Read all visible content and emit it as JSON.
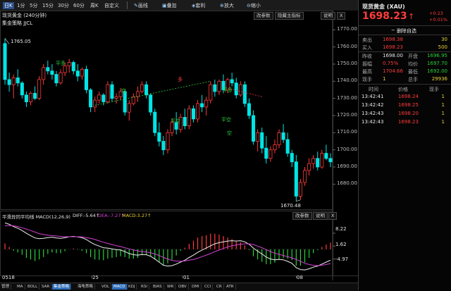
{
  "toolbar": {
    "intervals": [
      "日K",
      "1分",
      "5分",
      "15分",
      "30分",
      "60分"
    ],
    "active_interval": "日K",
    "buttons": [
      "周K",
      "自定义"
    ],
    "tools": [
      "画线",
      "叠加",
      "套利",
      "放大",
      "缩小"
    ]
  },
  "chart_header": {
    "title": "现货黄金 (240分钟)",
    "strategy": "集金策略 JJCL",
    "btn_params": "改参数",
    "btn_hide": "隐藏主指标",
    "btn_explain": "说明",
    "btn_close": "X"
  },
  "price_axis": [
    "1770.00",
    "1760.00",
    "1750.00",
    "1740.00",
    "1730.00",
    "1720.00",
    "1710.00",
    "1700.00",
    "1690.00",
    "1680.00"
  ],
  "annotations": {
    "high": "1765.05",
    "low": "1670.48",
    "markers": [
      "平多",
      "空",
      "平空",
      "平多",
      "平空",
      "空",
      "多"
    ]
  },
  "macd_header": {
    "title": "平滑异同平均线 MACD(12,26,9)",
    "diff": "DIFF:-5.64↑",
    "dea": "DEA:-7.27↑",
    "macd": "MACD:3.27↑",
    "btn_params": "改参数",
    "btn_explain": "说明",
    "btn_close": "X"
  },
  "macd_axis": [
    "8.22",
    "1.62",
    "-4.97"
  ],
  "date_axis": [
    "0518",
    "25",
    "01",
    "08"
  ],
  "bottom_tabs": [
    "管理",
    "MA",
    "BOLL",
    "SAR",
    "集金策略",
    "海龟策略",
    "VOL",
    "MACD",
    "KDJ",
    "RSI",
    "BIAS",
    "WR",
    "OBV",
    "DMI",
    "CCI",
    "CR",
    "ATR"
  ],
  "active_bottom_tab": "集金策略",
  "chart_data": {
    "type": "candlestick",
    "price_ylim": [
      1667,
      1773
    ],
    "candles": [
      [
        1762,
        1765,
        1738,
        1741
      ],
      [
        1741,
        1745,
        1734,
        1738
      ],
      [
        1738,
        1744,
        1730,
        1742
      ],
      [
        1742,
        1747,
        1737,
        1739
      ],
      [
        1739,
        1740,
        1730,
        1732
      ],
      [
        1732,
        1734,
        1725,
        1728
      ],
      [
        1728,
        1734,
        1726,
        1733
      ],
      [
        1733,
        1737,
        1729,
        1730
      ],
      [
        1730,
        1743,
        1729,
        1741
      ],
      [
        1741,
        1750,
        1738,
        1748
      ],
      [
        1748,
        1752,
        1744,
        1746
      ],
      [
        1746,
        1750,
        1741,
        1744
      ],
      [
        1744,
        1746,
        1737,
        1739
      ],
      [
        1739,
        1747,
        1738,
        1745
      ],
      [
        1745,
        1751,
        1743,
        1749
      ],
      [
        1749,
        1753,
        1745,
        1751
      ],
      [
        1751,
        1752,
        1744,
        1746
      ],
      [
        1746,
        1750,
        1740,
        1743
      ],
      [
        1743,
        1748,
        1741,
        1747
      ],
      [
        1747,
        1749,
        1733,
        1735
      ],
      [
        1735,
        1736,
        1722,
        1725
      ],
      [
        1725,
        1731,
        1722,
        1729
      ],
      [
        1729,
        1734,
        1727,
        1732
      ],
      [
        1732,
        1733,
        1726,
        1728
      ],
      [
        1728,
        1740,
        1727,
        1738
      ],
      [
        1738,
        1740,
        1728,
        1730
      ],
      [
        1730,
        1733,
        1727,
        1731
      ],
      [
        1731,
        1736,
        1729,
        1734
      ],
      [
        1734,
        1735,
        1720,
        1722
      ],
      [
        1722,
        1729,
        1717,
        1727
      ],
      [
        1727,
        1733,
        1726,
        1731
      ],
      [
        1731,
        1737,
        1728,
        1734
      ],
      [
        1734,
        1740,
        1733,
        1738
      ],
      [
        1738,
        1740,
        1730,
        1732
      ],
      [
        1732,
        1733,
        1720,
        1722
      ],
      [
        1722,
        1724,
        1708,
        1710
      ],
      [
        1710,
        1716,
        1702,
        1705
      ],
      [
        1705,
        1708,
        1697,
        1700
      ],
      [
        1700,
        1712,
        1698,
        1710
      ],
      [
        1710,
        1718,
        1708,
        1716
      ],
      [
        1716,
        1722,
        1709,
        1712
      ],
      [
        1712,
        1721,
        1710,
        1719
      ],
      [
        1719,
        1724,
        1712,
        1714
      ],
      [
        1714,
        1726,
        1712,
        1724
      ],
      [
        1724,
        1726,
        1716,
        1718
      ],
      [
        1718,
        1729,
        1716,
        1727
      ],
      [
        1727,
        1732,
        1722,
        1725
      ],
      [
        1725,
        1731,
        1720,
        1729
      ],
      [
        1729,
        1740,
        1727,
        1738
      ],
      [
        1738,
        1741,
        1731,
        1734
      ],
      [
        1734,
        1741,
        1732,
        1740
      ],
      [
        1740,
        1744,
        1733,
        1735
      ],
      [
        1735,
        1742,
        1733,
        1741
      ],
      [
        1741,
        1745,
        1737,
        1739
      ],
      [
        1739,
        1742,
        1730,
        1732
      ],
      [
        1732,
        1740,
        1731,
        1738
      ],
      [
        1738,
        1740,
        1725,
        1727
      ],
      [
        1727,
        1730,
        1718,
        1720
      ],
      [
        1720,
        1723,
        1703,
        1705
      ],
      [
        1705,
        1712,
        1699,
        1710
      ],
      [
        1710,
        1713,
        1698,
        1701
      ],
      [
        1701,
        1708,
        1692,
        1695
      ],
      [
        1695,
        1702,
        1693,
        1700
      ],
      [
        1700,
        1706,
        1698,
        1703
      ],
      [
        1703,
        1712,
        1701,
        1710
      ],
      [
        1710,
        1715,
        1704,
        1706
      ],
      [
        1706,
        1710,
        1696,
        1698
      ],
      [
        1698,
        1700,
        1690,
        1693
      ],
      [
        1693,
        1697,
        1670,
        1673
      ],
      [
        1673,
        1683,
        1671,
        1681
      ],
      [
        1681,
        1690,
        1679,
        1688
      ],
      [
        1688,
        1695,
        1685,
        1692
      ],
      [
        1692,
        1697,
        1689,
        1695
      ],
      [
        1695,
        1699,
        1688,
        1690
      ],
      [
        1690,
        1700,
        1689,
        1698
      ],
      [
        1698,
        1703,
        1694,
        1695
      ],
      [
        1695,
        1698,
        1690,
        1693
      ]
    ],
    "macd_ylim": [
      -12,
      14
    ],
    "diff": [
      13.5,
      12.8,
      11.6,
      10.8,
      9.6,
      8.2,
      7.0,
      5.8,
      5.4,
      5.6,
      6.0,
      6.2,
      5.8,
      5.6,
      5.9,
      6.4,
      6.6,
      6.3,
      5.9,
      5.0,
      3.6,
      2.4,
      1.6,
      0.8,
      0.6,
      0.2,
      -0.2,
      -0.4,
      -1.2,
      -2.2,
      -2.8,
      -3.0,
      -2.7,
      -2.8,
      -3.6,
      -5.0,
      -6.6,
      -8.2,
      -8.6,
      -8.4,
      -7.6,
      -6.6,
      -5.6,
      -4.2,
      -3.0,
      -1.6,
      -0.4,
      0.6,
      1.8,
      2.8,
      3.4,
      3.8,
      4.2,
      4.4,
      4.2,
      4.4,
      3.8,
      2.6,
      0.6,
      -1.0,
      -2.4,
      -4.0,
      -5.0,
      -5.4,
      -5.2,
      -5.4,
      -6.2,
      -7.2,
      -9.4,
      -10.4,
      -10.6,
      -10.0,
      -9.2,
      -8.6,
      -7.6,
      -6.6,
      -5.6
    ],
    "dea": [
      12.0,
      12.2,
      12.0,
      11.6,
      11.0,
      10.4,
      9.6,
      8.8,
      8.0,
      7.6,
      7.2,
      7.0,
      6.8,
      6.6,
      6.4,
      6.4,
      6.4,
      6.4,
      6.3,
      6.0,
      5.6,
      5.0,
      4.3,
      3.6,
      3.0,
      2.4,
      1.8,
      1.4,
      0.8,
      0.2,
      -0.4,
      -0.8,
      -1.2,
      -1.4,
      -1.8,
      -2.4,
      -3.2,
      -4.2,
      -5.0,
      -5.7,
      -6.0,
      -6.2,
      -6.0,
      -5.6,
      -5.2,
      -4.6,
      -3.8,
      -3.0,
      -2.2,
      -1.2,
      -0.4,
      0.4,
      1.2,
      1.8,
      2.2,
      2.6,
      2.8,
      2.8,
      2.4,
      1.6,
      0.8,
      -0.2,
      -1.2,
      -2.0,
      -2.6,
      -3.2,
      -3.8,
      -4.4,
      -5.2,
      -6.2,
      -7.2,
      -7.8,
      -8.2,
      -8.4,
      -8.2,
      -7.8,
      -7.3
    ]
  },
  "quote": {
    "title": "现货黄金 (XAU)",
    "price": "1698.23",
    "arrow": "↑",
    "change": "+0.23",
    "change_pct": "+0.01%",
    "self_select": "删除自选",
    "sell_label": "卖出",
    "sell_price": "1698.38",
    "sell_qty": "30",
    "buy_label": "买入",
    "buy_price": "1698.23",
    "buy_qty": "500",
    "rows": [
      {
        "l1": "昨收",
        "v1": "1698.00",
        "l2": "开盘",
        "v2": "1696.95"
      },
      {
        "l1": "振幅",
        "v1": "0.75%",
        "l2": "均价",
        "v2": "1697.70"
      },
      {
        "l1": "最高",
        "v1": "1704.66",
        "l2": "最低",
        "v2": "1692.00"
      },
      {
        "l1": "现手",
        "v1": "1",
        "l2": "总手",
        "v2": "29936"
      }
    ],
    "ticks_header": [
      "时间",
      "价格",
      "现手"
    ],
    "ticks": [
      {
        "time": "13:42:41",
        "price": "1698.24",
        "qty": "1"
      },
      {
        "time": "13:42:42",
        "price": "1698.25",
        "qty": "1"
      },
      {
        "time": "13:42:43",
        "price": "1698.20",
        "qty": "1"
      },
      {
        "time": "13:42:43",
        "price": "1698.23",
        "qty": "1"
      }
    ]
  },
  "colors": {
    "up": "#ff3b3b",
    "down": "#00e5e5",
    "diff": "#f0f0f0",
    "dea": "#d43fd4",
    "signal_up": "#2bd03b"
  }
}
